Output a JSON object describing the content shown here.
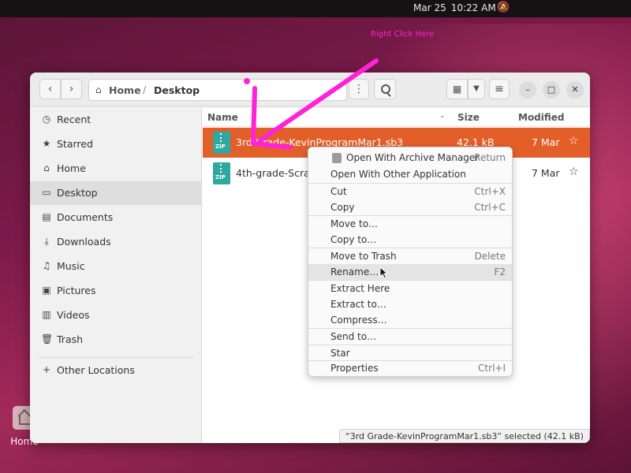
{
  "top_bar": {
    "date": "Mar 25",
    "time": "10:22 AM"
  },
  "desktop_icons": [
    {
      "label": "Home",
      "icon": "home-icon"
    }
  ],
  "annotation": {
    "text": "Right Click Here",
    "color": "#ff22d8"
  },
  "window": {
    "path": {
      "home": "Home",
      "current": "Desktop"
    },
    "sidebar": {
      "items": [
        {
          "label": "Recent",
          "icon": "clock-icon"
        },
        {
          "label": "Starred",
          "icon": "star-icon"
        },
        {
          "label": "Home",
          "icon": "home-icon"
        },
        {
          "label": "Desktop",
          "icon": "desktop-icon",
          "active": true
        },
        {
          "label": "Documents",
          "icon": "documents-icon"
        },
        {
          "label": "Downloads",
          "icon": "download-icon"
        },
        {
          "label": "Music",
          "icon": "music-icon"
        },
        {
          "label": "Pictures",
          "icon": "pictures-icon"
        },
        {
          "label": "Videos",
          "icon": "videos-icon"
        },
        {
          "label": "Trash",
          "icon": "trash-icon"
        },
        {
          "label": "Other Locations",
          "icon": "plus-icon"
        }
      ]
    },
    "columns": {
      "name": "Name",
      "size": "Size",
      "modified": "Modified"
    },
    "files": [
      {
        "name": "3rd Grade-KevinProgramMar1.sb3",
        "size": "42.1 kB",
        "modified": "7 Mar",
        "selected": true,
        "icon": "zip-icon",
        "icon_text": "ZIP"
      },
      {
        "name": "4th-grade-Scratch",
        "size": "",
        "modified": "7 Mar",
        "selected": false,
        "icon": "zip-icon",
        "icon_text": "ZIP"
      }
    ],
    "status": "“3rd Grade-KevinProgramMar1.sb3” selected  (42.1 kB)"
  },
  "context_menu": {
    "items": [
      {
        "label": "Open With Archive Manager",
        "shortcut": "Return"
      },
      {
        "label": "Open With Other Application",
        "shortcut": ""
      },
      {
        "label": "Cut",
        "shortcut": "Ctrl+X"
      },
      {
        "label": "Copy",
        "shortcut": "Ctrl+C"
      },
      {
        "label": "Move to…",
        "shortcut": ""
      },
      {
        "label": "Copy to…",
        "shortcut": ""
      },
      {
        "label": "Move to Trash",
        "shortcut": "Delete"
      },
      {
        "label": "Rename…",
        "shortcut": "F2",
        "hovered": true
      },
      {
        "label": "Extract Here",
        "shortcut": ""
      },
      {
        "label": "Extract to…",
        "shortcut": ""
      },
      {
        "label": "Compress…",
        "shortcut": ""
      },
      {
        "label": "Send to…",
        "shortcut": ""
      },
      {
        "label": "Star",
        "shortcut": ""
      },
      {
        "label": "Properties",
        "shortcut": "Ctrl+I"
      }
    ]
  }
}
